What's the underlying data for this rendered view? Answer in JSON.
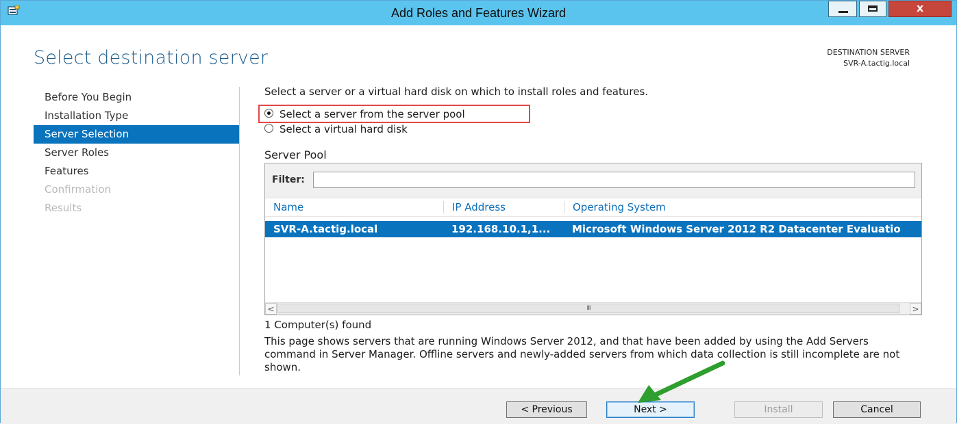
{
  "window": {
    "title": "Add Roles and Features Wizard",
    "close_glyph": "x"
  },
  "header": {
    "page_title": "Select destination server",
    "destination_label": "DESTINATION SERVER",
    "destination_value": "SVR-A.tactig.local"
  },
  "nav": {
    "items": [
      {
        "label": "Before You Begin",
        "state": "normal"
      },
      {
        "label": "Installation Type",
        "state": "normal"
      },
      {
        "label": "Server Selection",
        "state": "active"
      },
      {
        "label": "Server Roles",
        "state": "normal"
      },
      {
        "label": "Features",
        "state": "normal"
      },
      {
        "label": "Confirmation",
        "state": "disabled"
      },
      {
        "label": "Results",
        "state": "disabled"
      }
    ]
  },
  "main": {
    "intro": "Select a server or a virtual hard disk on which to install roles and features.",
    "options": [
      {
        "label": "Select a server from the server pool",
        "selected": true
      },
      {
        "label": "Select a virtual hard disk",
        "selected": false
      }
    ],
    "pool_label": "Server Pool",
    "filter_label": "Filter:",
    "filter_value": "",
    "columns": [
      "Name",
      "IP Address",
      "Operating System"
    ],
    "rows": [
      {
        "name": "SVR-A.tactig.local",
        "ip": "192.168.10.1,1...",
        "os": "Microsoft Windows Server 2012 R2 Datacenter Evaluatio",
        "selected": true
      }
    ],
    "scroll_left": "<",
    "scroll_right": ">",
    "scroll_grip": "III",
    "found": "1 Computer(s) found",
    "info": "This page shows servers that are running Windows Server 2012, and that have been added by using the Add Servers command in Server Manager. Offline servers and newly-added servers from which data collection is still incomplete are not shown."
  },
  "footer": {
    "previous": "< Previous",
    "next": "Next >",
    "install": "Install",
    "cancel": "Cancel"
  },
  "colors": {
    "titlebar": "#5bc4ee",
    "selection": "#0a73bd",
    "highlight_box": "#e04848",
    "annotation_arrow": "#2e9e2e"
  }
}
